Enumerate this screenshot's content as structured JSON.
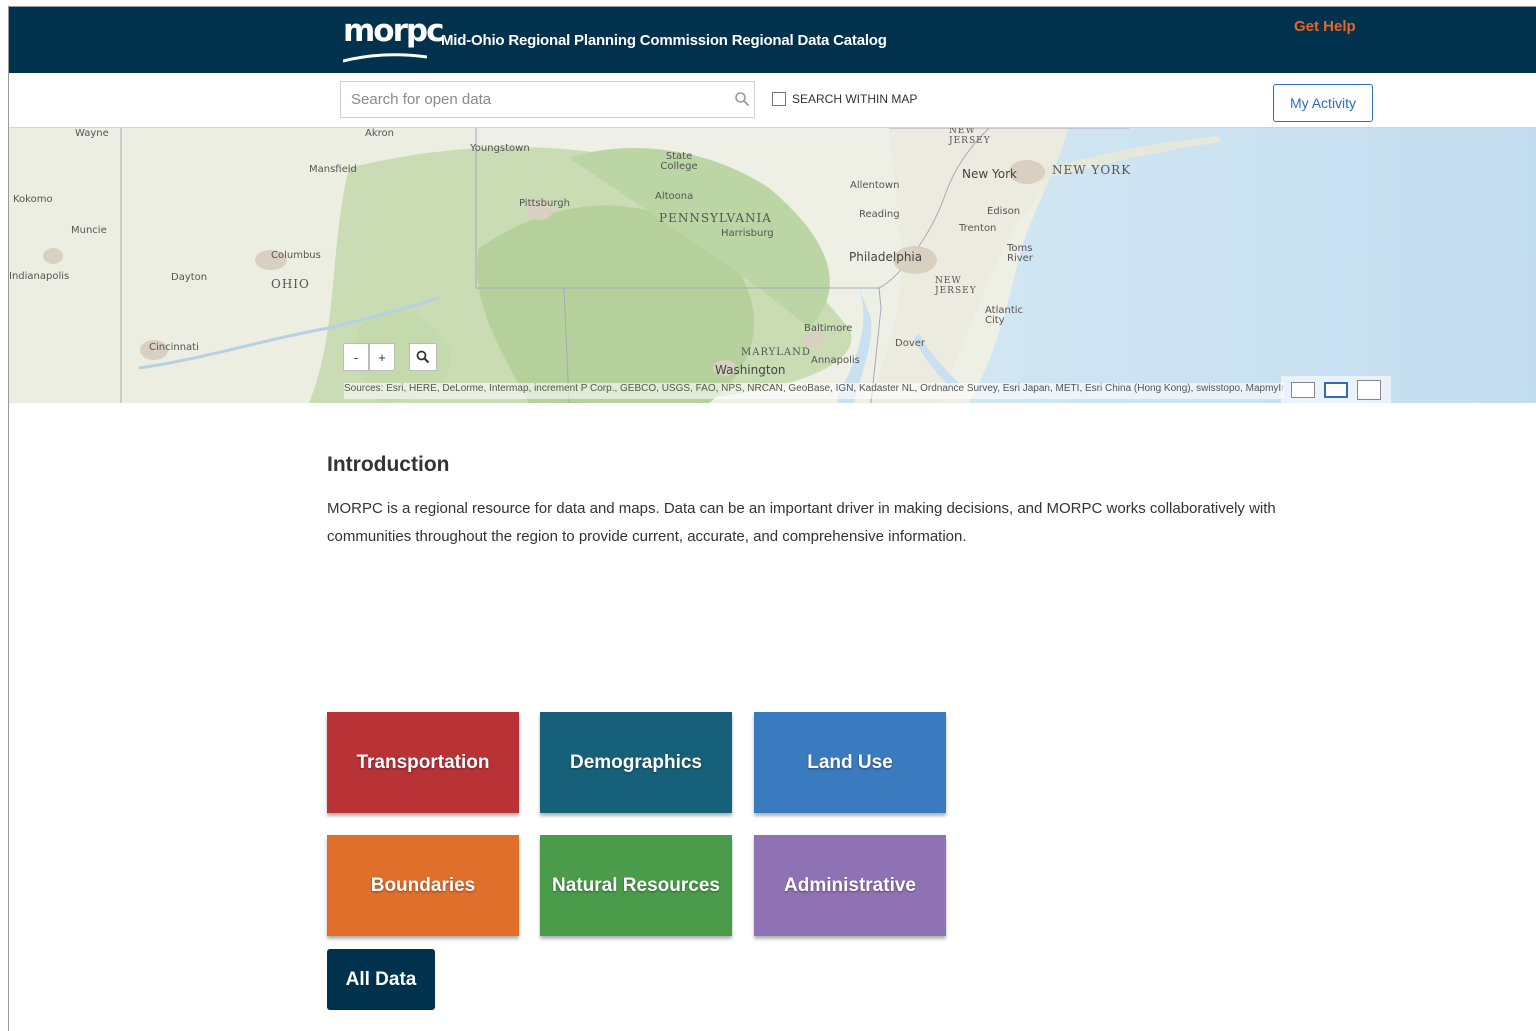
{
  "header": {
    "logo_text": "morpc",
    "site_title": "Mid-Ohio Regional Planning Commission Regional Data Catalog",
    "get_help": "Get Help"
  },
  "search": {
    "placeholder": "Search for open data",
    "within_map_label": "SEARCH WITHIN MAP",
    "my_activity_label": "My Activity"
  },
  "map": {
    "zoom_out": "-",
    "zoom_in": "+",
    "labels": {
      "wayne": "Wayne",
      "akron": "Akron",
      "youngstown": "Youngstown",
      "mansfield": "Mansfield",
      "state_college": "State College",
      "kokomo": "Kokomo",
      "muncie": "Muncie",
      "indianapolis": "Indianapolis",
      "columbus": "Columbus",
      "dayton": "Dayton",
      "ohio": "OHIO",
      "cincinnati": "Cincinnati",
      "pittsburgh": "Pittsburgh",
      "altoona": "Altoona",
      "pennsylvania": "PENNSYLVANIA",
      "harrisburg": "Harrisburg",
      "allentown": "Allentown",
      "reading": "Reading",
      "philadelphia": "Philadelphia",
      "new_york_city": "New York",
      "new_york_state": "NEW YORK",
      "edison": "Edison",
      "trenton": "Trenton",
      "toms_river": "Toms River",
      "new_jersey_top": "NEW JERSEY",
      "new_jersey": "NEW JERSEY",
      "atlantic_city": "Atlantic City",
      "baltimore": "Baltimore",
      "dover": "Dover",
      "maryland": "MARYLAND",
      "annapolis": "Annapolis",
      "washington": "Washington"
    },
    "attribution": "Sources: Esri, HERE, DeLorme, Intermap, increment P Corp., GEBCO, USGS, FAO, NPS, NRCAN, GeoBase, IGN, Kadaster NL, Ordnance Survey, Esri Japan, METI, Esri China (Hong Kong), swisstopo, MapmyIndia, © OpenStreetMap contributors, and the GIS User Community"
  },
  "intro": {
    "title": "Introduction",
    "text": "MORPC is a regional resource for data and maps. Data can be an important driver in making decisions, and MORPC works collaboratively with communities throughout the region to provide current, accurate, and comprehensive information."
  },
  "categories": [
    {
      "label": "Transportation",
      "color": "#b83236"
    },
    {
      "label": "Demographics",
      "color": "#17607a"
    },
    {
      "label": "Land Use",
      "color": "#3a7bbf"
    },
    {
      "label": "Boundaries",
      "color": "#e06f2c"
    },
    {
      "label": "Natural Resources",
      "color": "#4a9c4a"
    },
    {
      "label": "Administrative",
      "color": "#8f72b3"
    }
  ],
  "all_data_label": "All Data",
  "colors": {
    "header_bg": "#00324d",
    "get_help": "#e8652a",
    "accent": "#2f6ebd"
  }
}
